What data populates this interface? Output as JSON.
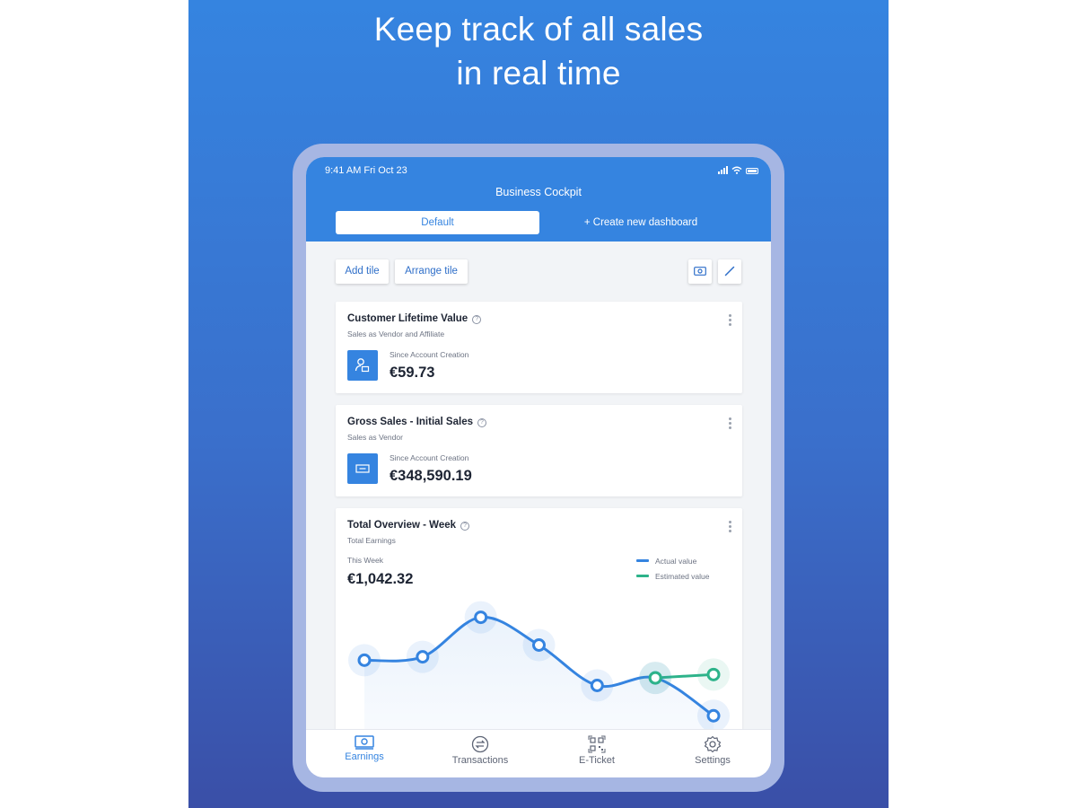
{
  "headline": {
    "line1": "Keep track of all sales",
    "line2": "in real time"
  },
  "status_bar": {
    "time": "9:41 AM   Fri Oct 23"
  },
  "header": {
    "title": "Business Cockpit"
  },
  "tabs": {
    "default_label": "Default",
    "create_label": "+ Create new dashboard"
  },
  "toolbar": {
    "add_tile": "Add tile",
    "arrange_tile": "Arrange tile"
  },
  "cards": [
    {
      "title": "Customer Lifetime Value",
      "subtitle": "Sales as Vendor and Affiliate",
      "label": "Since Account Creation",
      "value": "€59.73"
    },
    {
      "title": "Gross Sales - Initial Sales",
      "subtitle": "Sales as Vendor",
      "label": "Since Account Creation",
      "value": "€348,590.19"
    }
  ],
  "overview": {
    "title": "Total Overview - Week",
    "subtitle": "Total Earnings",
    "label": "This Week",
    "value": "€1,042.32",
    "legend_actual": "Actual value",
    "legend_estimated": "Estimated value"
  },
  "chart_data": {
    "type": "line",
    "title": "Total Overview - Week",
    "x": [
      1,
      2,
      3,
      4,
      5,
      6,
      7
    ],
    "series": [
      {
        "name": "Actual value",
        "values": [
          0.36,
          0.4,
          0.87,
          0.54,
          0.06,
          0.15,
          -0.3
        ]
      },
      {
        "name": "Estimated value",
        "values": [
          null,
          null,
          null,
          null,
          null,
          0.15,
          0.19
        ]
      }
    ],
    "ylim": [
      -0.5,
      1.1
    ],
    "grid": false
  },
  "colors": {
    "accent": "#3584e0",
    "estimated": "#2db38a",
    "text": "#1d2433"
  },
  "nav": [
    {
      "label": "Earnings",
      "icon": "banknote-icon"
    },
    {
      "label": "Transactions",
      "icon": "transfer-arrows-icon"
    },
    {
      "label": "E-Ticket",
      "icon": "qr-code-icon"
    },
    {
      "label": "Settings",
      "icon": "gear-icon"
    }
  ]
}
